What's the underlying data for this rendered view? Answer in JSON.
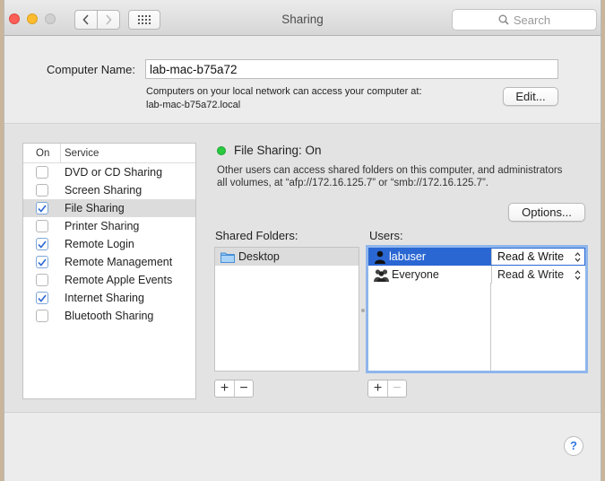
{
  "window": {
    "title": "Sharing"
  },
  "toolbar": {
    "search_placeholder": "Search",
    "back_icon": "chevron-left-icon",
    "forward_icon": "chevron-right-icon",
    "grid_icon": "show-all-grid-icon"
  },
  "computer": {
    "name_label": "Computer Name:",
    "name_value": "lab-mac-b75a72",
    "info_line1": "Computers on your local network can access your computer at:",
    "info_line2": "lab-mac-b75a72.local",
    "edit_label": "Edit..."
  },
  "services": {
    "header_on": "On",
    "header_service": "Service",
    "items": [
      {
        "label": "DVD or CD Sharing",
        "checked": false,
        "selected": false
      },
      {
        "label": "Screen Sharing",
        "checked": false,
        "selected": false
      },
      {
        "label": "File Sharing",
        "checked": true,
        "selected": true
      },
      {
        "label": "Printer Sharing",
        "checked": false,
        "selected": false
      },
      {
        "label": "Remote Login",
        "checked": true,
        "selected": false
      },
      {
        "label": "Remote Management",
        "checked": true,
        "selected": false
      },
      {
        "label": "Remote Apple Events",
        "checked": false,
        "selected": false
      },
      {
        "label": "Internet Sharing",
        "checked": true,
        "selected": false
      },
      {
        "label": "Bluetooth Sharing",
        "checked": false,
        "selected": false
      }
    ]
  },
  "status": {
    "text": "File Sharing: On",
    "color": "#29c940",
    "description_line1": "Other users can access shared folders on this computer, and administrators",
    "description_line2": "all volumes, at “afp://172.16.125.7” or “smb://172.16.125.7”."
  },
  "options_label": "Options...",
  "shared_folders": {
    "label": "Shared Folders:",
    "items": [
      {
        "name": "Desktop",
        "icon": "folder-icon"
      }
    ]
  },
  "users": {
    "label": "Users:",
    "items": [
      {
        "name": "labuser",
        "permission": "Read & Write",
        "icon": "user-icon",
        "selected": true
      },
      {
        "name": "Everyone",
        "permission": "Read & Write",
        "icon": "group-icon",
        "selected": false
      }
    ]
  },
  "buttons": {
    "add": "+",
    "remove": "−",
    "help": "?"
  },
  "colors": {
    "selection": "#2a67d3",
    "accent": "#3277e6"
  }
}
